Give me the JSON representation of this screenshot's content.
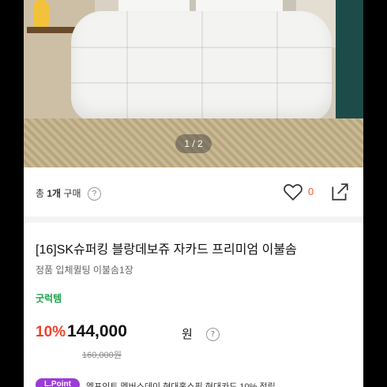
{
  "gallery": {
    "pager_text": "1 / 2"
  },
  "purchase": {
    "prefix": "총 ",
    "count": "1개",
    "suffix": " 구매",
    "help": "?"
  },
  "likes": {
    "count": "0"
  },
  "product": {
    "title": "[16]SK슈퍼킹 블랑데보쥬 자카드 프리미엄 이불솜",
    "subtitle": "정품 입체퀼팅 이불솜1장",
    "goods_label": "굿럭템"
  },
  "pricing": {
    "discount": "10%",
    "price": "144,000",
    "unit": "원",
    "help": "?",
    "original": "160,000원"
  },
  "promo": {
    "badge": "L.Point",
    "text": "엘포인트 멤버스데이 현대홈쇼핑 현대카드 10% 적립"
  },
  "colors": {
    "accent_red": "#f0412b",
    "goods_green": "#1aa04b",
    "like_orange": "#f05a28"
  }
}
